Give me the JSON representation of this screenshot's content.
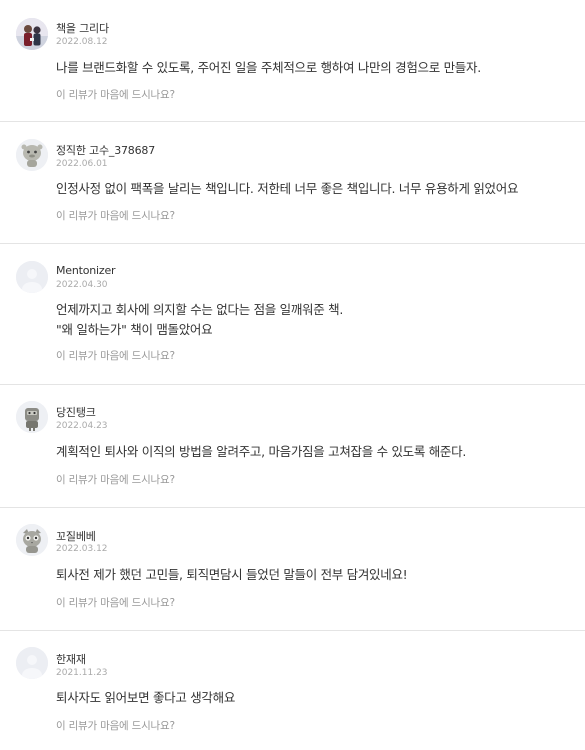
{
  "reviews": [
    {
      "nickname": "책을 그리다",
      "date": "2022.08.12",
      "avatar_icon": "profile-photo-icon",
      "text_lines": [
        "나를 브랜드화할 수 있도록, 주어진 일을 주체적으로 행하여 나만의 경험으로 만들자."
      ],
      "helpful_label": "이 리뷰가 마음에 드시나요?"
    },
    {
      "nickname": "정직한 고수_378687",
      "date": "2022.06.01",
      "avatar_icon": "character-avatar-icon",
      "text_lines": [
        "인정사정 없이 팩폭을 날리는 책입니다. 저한테 너무 좋은 책입니다. 너무 유용하게 읽었어요"
      ],
      "helpful_label": "이 리뷰가 마음에 드시나요?"
    },
    {
      "nickname": "Mentonizer",
      "date": "2022.04.30",
      "avatar_icon": "default-avatar-icon",
      "text_lines": [
        "언제까지고 회사에 의지할 수는 없다는 점을 일깨워준 책.",
        "\"왜 일하는가\" 책이 맴돌았어요"
      ],
      "helpful_label": "이 리뷰가 마음에 드시나요?"
    },
    {
      "nickname": "당진탱크",
      "date": "2022.04.23",
      "avatar_icon": "character-avatar-icon",
      "text_lines": [
        "계획적인 퇴사와 이직의 방법을 알려주고, 마음가짐을 고쳐잡을 수 있도록 해준다."
      ],
      "helpful_label": "이 리뷰가 마음에 드시나요?"
    },
    {
      "nickname": "꼬질베베",
      "date": "2022.03.12",
      "avatar_icon": "character-avatar-icon",
      "text_lines": [
        "퇴사전 제가 했던 고민들, 퇴직면담시 들었던 말들이 전부 담겨있네요!"
      ],
      "helpful_label": "이 리뷰가 마음에 드시나요?"
    },
    {
      "nickname": "한재재",
      "date": "2021.11.23",
      "avatar_icon": "default-avatar-icon",
      "text_lines": [
        "퇴사자도 읽어보면 좋다고 생각해요"
      ],
      "helpful_label": "이 리뷰가 마음에 드시나요?"
    }
  ]
}
